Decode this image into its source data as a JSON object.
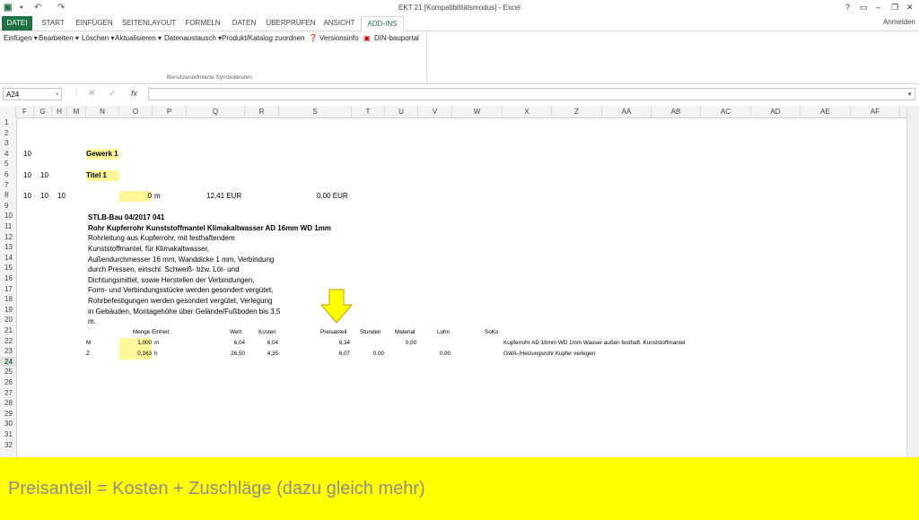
{
  "window": {
    "title": "EKT 21 [Kompatibilitätsmodus] - Excel",
    "help": "?",
    "sign_in": "Anmelden"
  },
  "tabs": [
    "DATEI",
    "START",
    "EINFÜGEN",
    "SEITENLAYOUT",
    "FORMELN",
    "DATEN",
    "ÜBERPRÜFEN",
    "ANSICHT",
    "ADD-INS"
  ],
  "active_tab": "ADD-INS",
  "ribbon": {
    "buttons": [
      "Einfügen ▾",
      "Bearbeiten ▾",
      "Löschen ▾",
      "Aktualisieren ▾",
      "Datenaustausch ▾",
      "Produkt/Katalog zuordnen",
      "Versionsinfo",
      "DIN-bauportal"
    ],
    "group_label": "Benutzerdefinierte Symbolleisten"
  },
  "formula_bar": {
    "name_box": "A24",
    "fx": "fx",
    "value": ""
  },
  "columns": [
    "F",
    "G",
    "H",
    "M",
    "N",
    "O",
    "P",
    "Q",
    "R",
    "S",
    "T",
    "U",
    "V",
    "W",
    "X",
    "Z",
    "AA",
    "AB",
    "AC",
    "AD",
    "AE",
    "AF"
  ],
  "rows": [
    "1",
    "2",
    "3",
    "4",
    "5",
    "6",
    "7",
    "8",
    "9",
    "10",
    "11",
    "12",
    "13",
    "14",
    "15",
    "16",
    "17",
    "18",
    "19",
    "20",
    "21",
    "22",
    "23",
    "24",
    "25",
    "26",
    "27",
    "28",
    "29",
    "30",
    "31",
    "32"
  ],
  "selected_row": "24",
  "cells": {
    "r4_f": "10",
    "r4_n": "Gewerk 1",
    "r6_f": "10",
    "r6_g": "10",
    "r6_n": "Titel 1",
    "r8_f": "10",
    "r8_g": "10",
    "r8_h": "10",
    "r8_o": "0",
    "r8_unit": "m",
    "r8_q": "12,41 EUR",
    "r8_s": "0,00 EUR",
    "r10": "STLB-Bau 04/2017 041",
    "r11": "Rohr Kupferrohr Kunststoffmantel Klimakaltwasser AD 16mm WD 1mm",
    "r12": "Rohrleitung aus Kupferrohr, mit festhaftendem",
    "r13": "Kunststoffmantel, für Klimakaltwasser,",
    "r14": "Außendurchmesser 16 mm, Wanddicke 1 mm, Verbindung",
    "r15": "durch Pressen, einschl. Schweiß- bzw. Löt- und",
    "r16": "Dichtungsmittel, sowie Herstellen der Verbindungen,",
    "r17": "Form- und Verbindungsstücke werden gesondert vergütet,",
    "r18": "Rohrbefestigungen werden gesondert vergütet, Verlegung",
    "r19": "in Gebäuden, Montagehöhe über Gelände/Fußboden bis 3,5",
    "r20": "m.",
    "h_menge": "Menge Einheit",
    "h_wert": "Wert",
    "h_kosten": "Kosten",
    "h_preisanteil": "Preisanteil",
    "h_stunden": "Stunden",
    "h_material": "Material",
    "h_lohn": "Lohn",
    "h_soko": "SoKo",
    "r22_type": "M",
    "r22_menge": "1,000",
    "r22_unit": "m",
    "r22_wert": "6,04",
    "r22_kosten": "6,04",
    "r22_preis": "6,34",
    "r22_material": "0,00",
    "r22_desc": "Kupferrohr AD 16mm WD 1mm Wasser außen festhaft. Kunststoffmantel",
    "r23_type": "Z",
    "r23_menge": "0,163",
    "r23_unit": "h",
    "r23_wert": "26,50",
    "r23_kosten": "4,35",
    "r23_preis": "6,07",
    "r23_stunden": "0,00",
    "r23_lohn": "0,00",
    "r23_desc": "GWA-/Heizungsrohr Kupfer verlegen"
  },
  "caption": "Preisanteil = Kosten + Zuschläge (dazu gleich mehr)",
  "colors": {
    "excel_green": "#217346",
    "cell_highlight": "#fff799",
    "caption_bg": "#ffff00",
    "arrow": "#ffff00"
  }
}
